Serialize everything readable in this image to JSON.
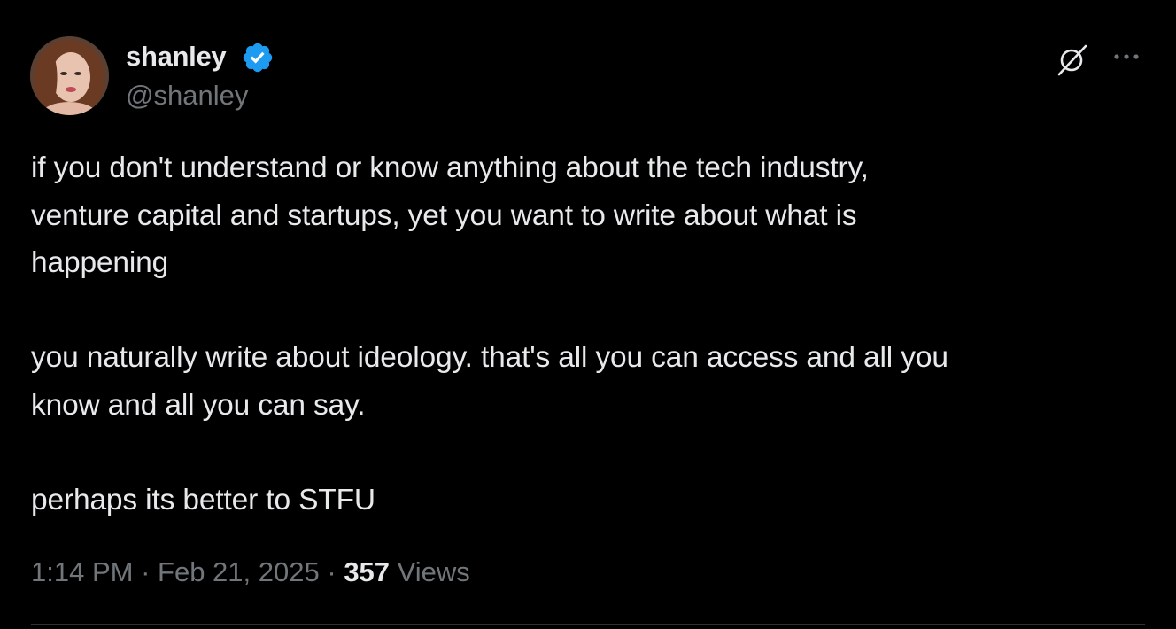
{
  "author": {
    "display_name": "shanley",
    "handle": "@shanley",
    "verified": true
  },
  "tweet": {
    "paragraphs": [
      "if you don't understand or know anything about the tech industry,\nventure capital and startups, yet you want to write about what is\nhappening",
      "you naturally write about ideology. that's all you can access and all you\nknow and all you can say.",
      "perhaps its better to STFU"
    ]
  },
  "meta": {
    "time": "1:14 PM",
    "separator": "·",
    "date": "Feb 21, 2025",
    "views_count": "357",
    "views_label": "Views"
  },
  "icons": {
    "verified": "verified-badge-icon",
    "grok": "grok-icon",
    "more": "more-options-icon"
  },
  "colors": {
    "background": "#000000",
    "primary_text": "#e7e9ea",
    "secondary_text": "#71767b",
    "verified_blue": "#1d9bf0"
  }
}
